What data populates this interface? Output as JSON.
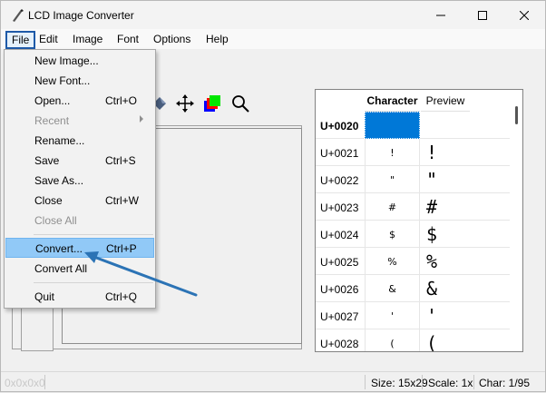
{
  "window": {
    "title": "LCD Image Converter"
  },
  "menubar": [
    "File",
    "Edit",
    "Image",
    "Font",
    "Options",
    "Help"
  ],
  "file_menu": [
    {
      "label": "New Image...",
      "shortcut": "",
      "disabled": false
    },
    {
      "label": "New Font...",
      "shortcut": "",
      "disabled": false
    },
    {
      "label": "Open...",
      "shortcut": "Ctrl+O",
      "disabled": false
    },
    {
      "label": "Recent",
      "shortcut": "",
      "disabled": true,
      "submenu": true
    },
    {
      "label": "Rename...",
      "shortcut": "",
      "disabled": false
    },
    {
      "label": "Save",
      "shortcut": "Ctrl+S",
      "disabled": false
    },
    {
      "label": "Save As...",
      "shortcut": "",
      "disabled": false
    },
    {
      "label": "Close",
      "shortcut": "Ctrl+W",
      "disabled": false
    },
    {
      "label": "Close All",
      "shortcut": "",
      "disabled": true
    },
    {
      "label": "Convert...",
      "shortcut": "Ctrl+P",
      "disabled": false,
      "highlighted": true
    },
    {
      "label": "Convert All",
      "shortcut": "",
      "disabled": false
    },
    {
      "label": "Quit",
      "shortcut": "Ctrl+Q",
      "disabled": false
    }
  ],
  "table": {
    "headers": [
      "Character",
      "Preview"
    ],
    "rows": [
      {
        "code": "U+0020",
        "char": "",
        "preview": "",
        "selected": true
      },
      {
        "code": "U+0021",
        "char": "!",
        "preview": "!"
      },
      {
        "code": "U+0022",
        "char": "\"",
        "preview": "\""
      },
      {
        "code": "U+0023",
        "char": "#",
        "preview": "#"
      },
      {
        "code": "U+0024",
        "char": "$",
        "preview": "$"
      },
      {
        "code": "U+0025",
        "char": "%",
        "preview": "%"
      },
      {
        "code": "U+0026",
        "char": "&",
        "preview": "&"
      },
      {
        "code": "U+0027",
        "char": "'",
        "preview": "'"
      },
      {
        "code": "U+0028",
        "char": "(",
        "preview": "("
      }
    ]
  },
  "status": {
    "left": "0x0x0x0",
    "size": "Size: 15x29",
    "scale": "Scale: 1x",
    "char": "Char: 1/95"
  },
  "toolbar_icons": [
    "fill-icon",
    "move-icon",
    "color-swatch-icon",
    "zoom-icon"
  ],
  "colors": {
    "accent": "#0078d7",
    "menu_highlight": "#91c9f7",
    "annotation_arrow": "#2b73b5"
  }
}
